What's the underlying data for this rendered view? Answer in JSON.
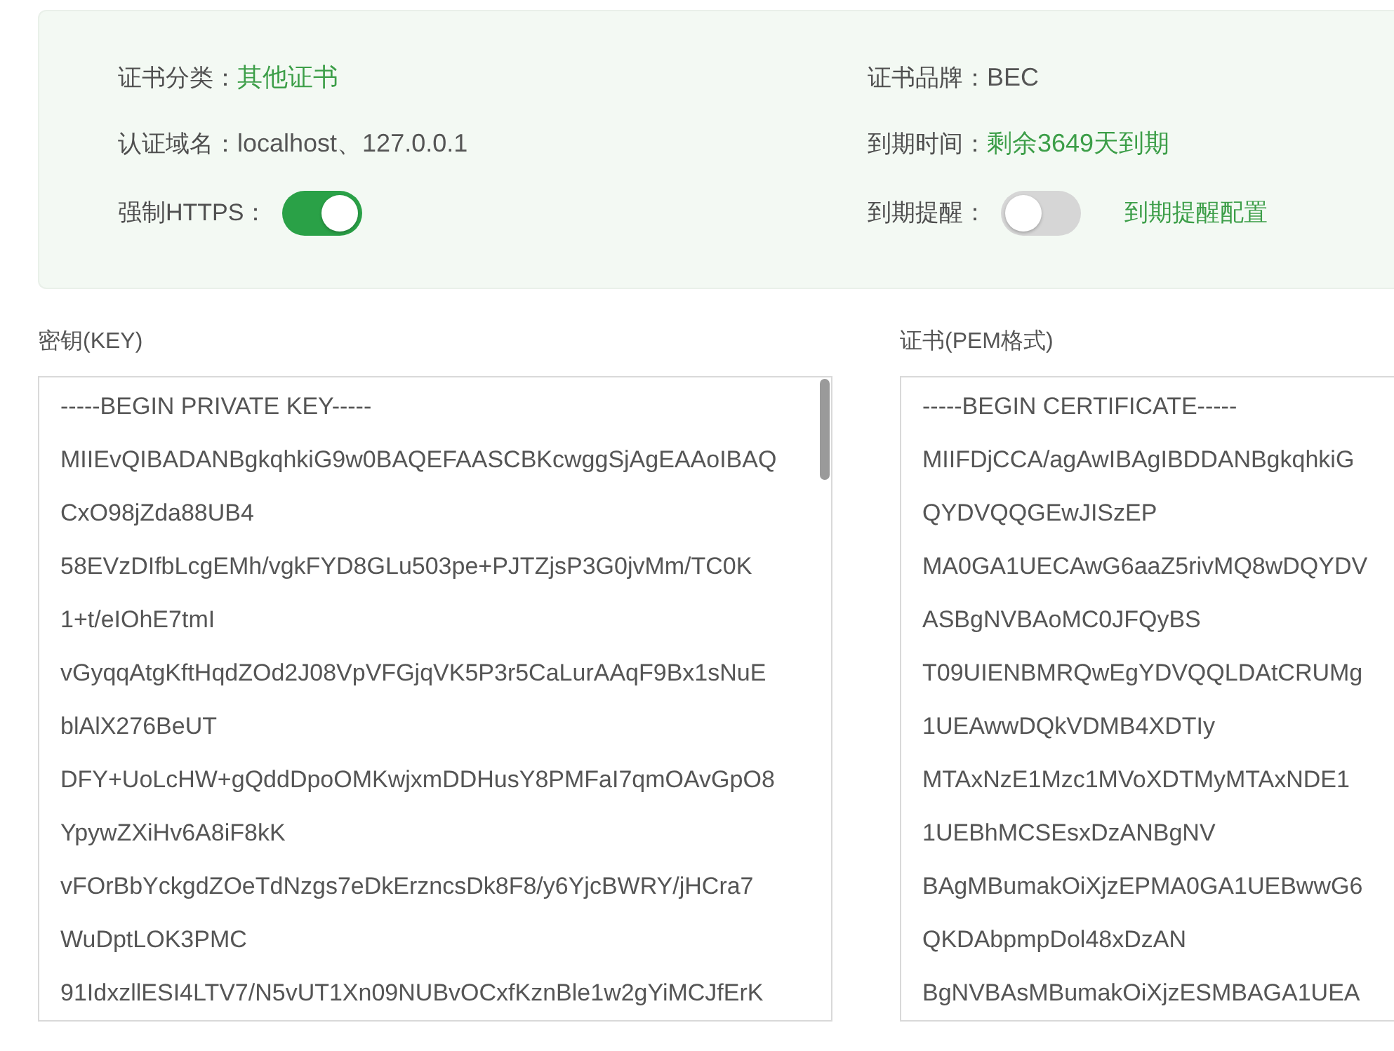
{
  "info_panel": {
    "fields": [
      {
        "kind": "text",
        "label": "证书分类：",
        "value": "其他证书",
        "color": "#3c9e48"
      },
      {
        "kind": "text",
        "label": "证书品牌：",
        "value": "BEC",
        "color": "#555555"
      },
      {
        "kind": "text",
        "label": "认证域名：",
        "value": "localhost、127.0.0.1",
        "color": "#555555"
      },
      {
        "kind": "text",
        "label": "到期时间：",
        "value": "剩余3649天到期",
        "color": "#3c9e48"
      },
      {
        "kind": "switch",
        "label": "强制HTTPS：",
        "on": true
      },
      {
        "kind": "switch",
        "label": "到期提醒：",
        "on": false,
        "link": "到期提醒配置"
      }
    ]
  },
  "key_field": {
    "label": "密钥(KEY)",
    "lines": [
      "-----BEGIN PRIVATE KEY-----",
      "MIIEvQIBADANBgkqhkiG9w0BAQEFAASCBKcwggSjAgEAAoIBAQ",
      "CxO98jZda88UB4",
      "58EVzDIfbLcgEMh/vgkFYD8GLu503pe+PJTZjsP3G0jvMm/TC0K",
      "1+t/eIOhE7tmI",
      "vGyqqAtgKftHqdZOd2J08VpVFGjqVK5P3r5CaLurAAqF9Bx1sNuE",
      "blAlX276BeUT",
      "DFY+UoLcHW+gQddDpoOMKwjxmDDHusY8PMFaI7qmOAvGpO8",
      "YpywZXiHv6A8iF8kK",
      "vFOrBbYckgdZOeTdNzgs7eDkErzncsDk8F8/y6YjcBWRY/jHCra7",
      "WuDptLOK3PMC",
      "91IdxzllESI4LTV7/N5vUT1Xn09NUBvOCxfKznBle1w2gYiMCJfErK"
    ]
  },
  "certificate_field": {
    "label": "证书(PEM格式)",
    "lines": [
      "-----BEGIN CERTIFICATE-----",
      "MIIFDjCCA/agAwIBAgIBDDANBgkqhkiG",
      "QYDVQQGEwJISzEP",
      "MA0GA1UECAwG6aaZ5rivMQ8wDQYDV",
      "ASBgNVBAoMC0JFQyBS",
      "T09UIENBMRQwEgYDVQQLDAtCRUMg",
      "1UEAwwDQkVDMB4XDTIy",
      "MTAxNzE1Mzc1MVoXDTMyMTAxNDE1",
      "1UEBhMCSEsxDzANBgNV",
      "BAgMBumakOiXjzEPMA0GA1UEBwwG6",
      "QKDAbpmpDol48xDzAN",
      "BgNVBAsMBumakOiXjzESMBAGA1UEA"
    ]
  }
}
